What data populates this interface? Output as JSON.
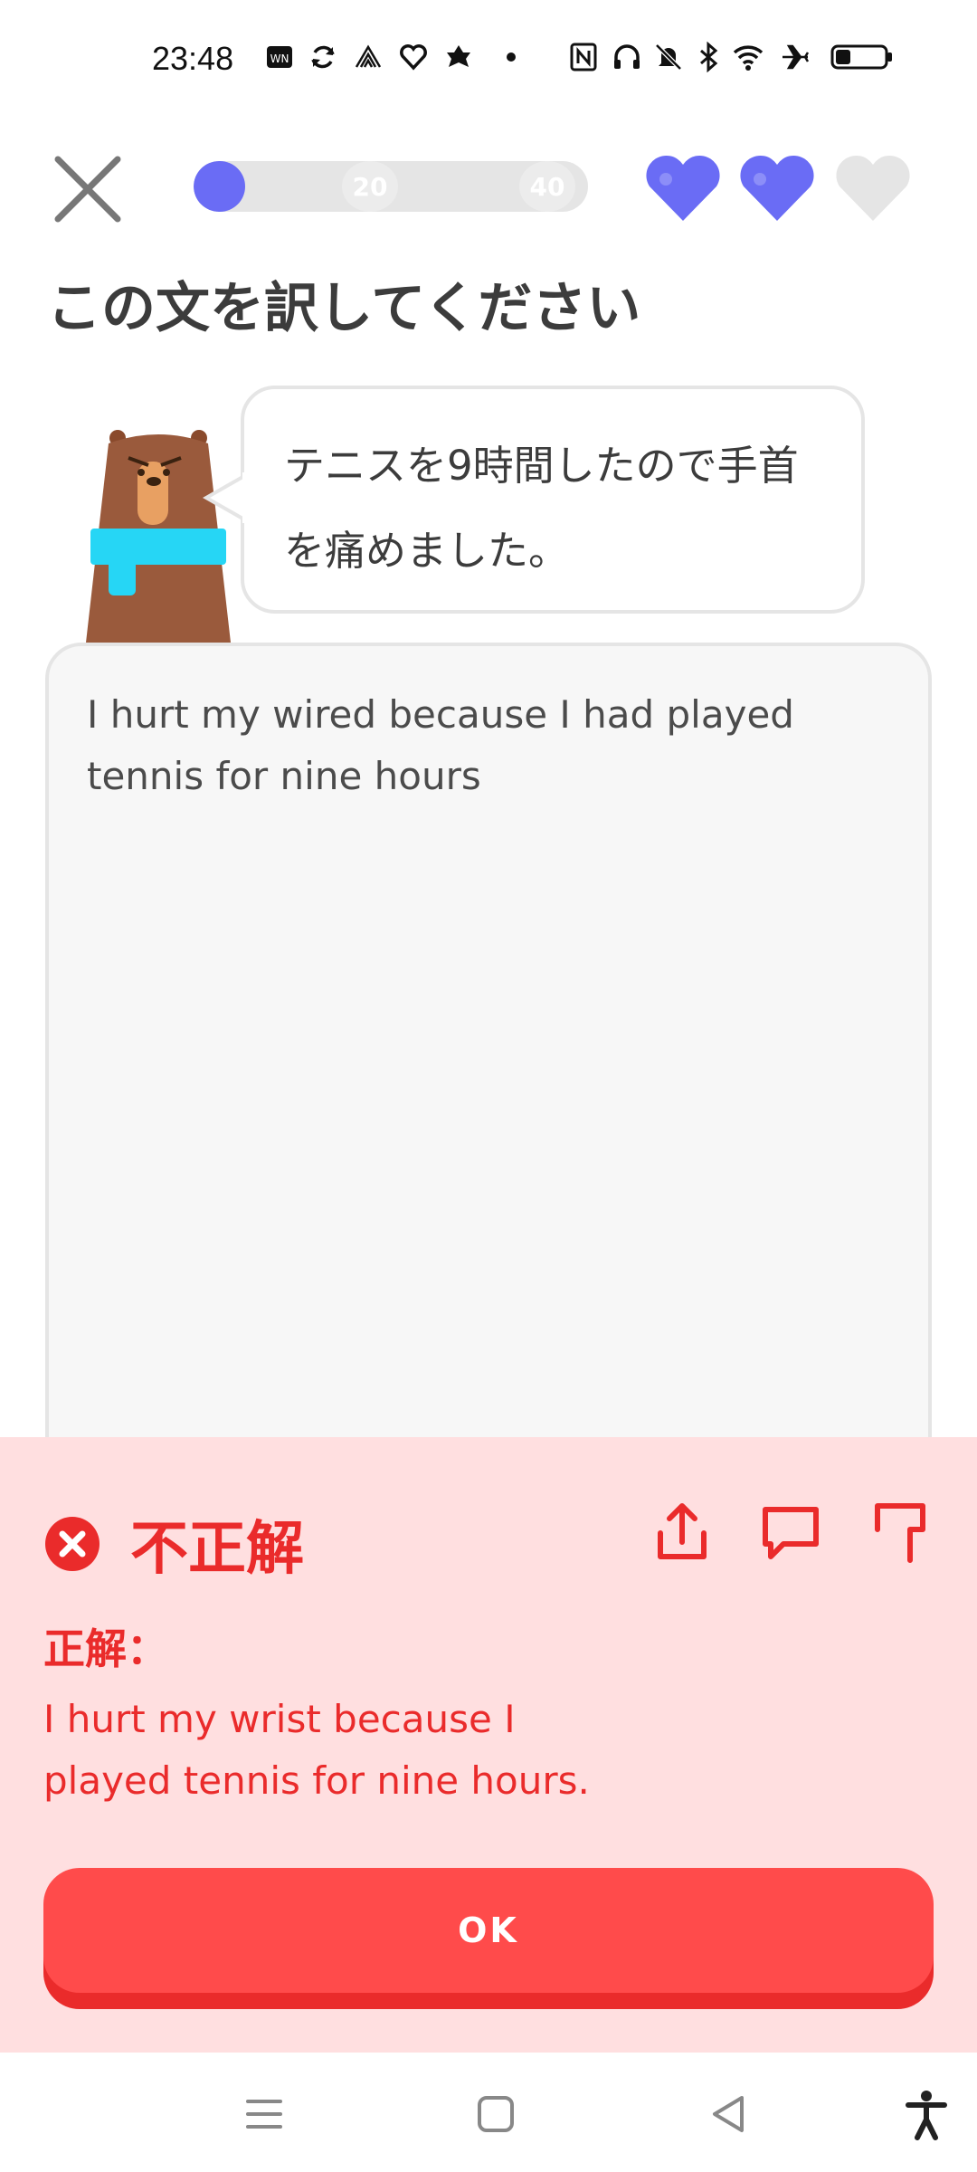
{
  "status_bar": {
    "time": "23:48"
  },
  "header": {
    "progress": {
      "fraction": 0.13,
      "milestones": [
        "20",
        "40"
      ]
    },
    "hearts": {
      "filled": 2,
      "total": 3,
      "color": "#6a6cf5",
      "empty_color": "#e5e5e5"
    }
  },
  "prompt": {
    "title": "この文を訳してください",
    "sentence_line1": "テニスを9時間したので手首",
    "sentence_line2": "を痛めました。"
  },
  "answer": {
    "user_text": "I hurt my wired because I had played tennis for nine hours"
  },
  "feedback": {
    "title": "不正解",
    "correct_label": "正解：",
    "correct_line1": "I hurt my wrist because I",
    "correct_line2": "played tennis for nine hours.",
    "ok_label": "OK",
    "colors": {
      "panel": "#ffdfe0",
      "accent": "#ea2b2b",
      "button": "#ff4b4b"
    }
  },
  "icons": {
    "close": "close-icon",
    "share": "share-icon",
    "comment": "comment-icon",
    "report": "flag-icon"
  }
}
